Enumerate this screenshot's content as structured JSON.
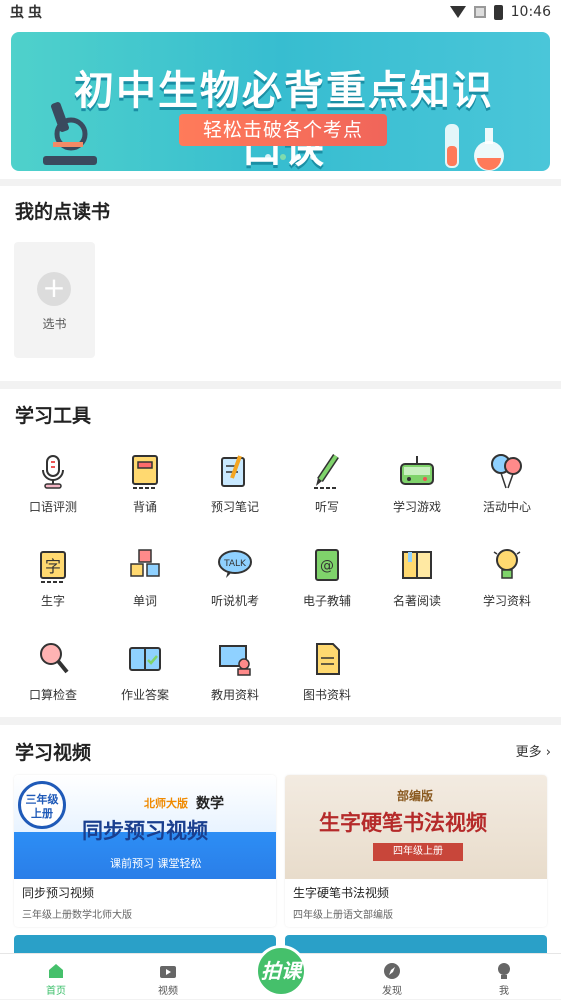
{
  "status_bar": {
    "left_icons": [
      "虫",
      "虫"
    ],
    "time": "10:46"
  },
  "banner": {
    "title": "初中生物必背重点知识口诀",
    "subtitle": "轻松击破各个考点",
    "slides": 4,
    "active_slide": 2
  },
  "my_books": {
    "title": "我的点读书",
    "add_label": "选书"
  },
  "tools": {
    "title": "学习工具",
    "items": [
      {
        "label": "口语评测",
        "icon": "microphone-icon"
      },
      {
        "label": "背诵",
        "icon": "book-icon"
      },
      {
        "label": "预习笔记",
        "icon": "notebook-pen-icon"
      },
      {
        "label": "听写",
        "icon": "pencil-icon"
      },
      {
        "label": "学习游戏",
        "icon": "gamepad-icon"
      },
      {
        "label": "活动中心",
        "icon": "balloons-icon"
      },
      {
        "label": "生字",
        "icon": "character-card-icon"
      },
      {
        "label": "单词",
        "icon": "letter-blocks-icon"
      },
      {
        "label": "听说机考",
        "icon": "talk-bubble-icon"
      },
      {
        "label": "电子教辅",
        "icon": "email-book-icon"
      },
      {
        "label": "名著阅读",
        "icon": "open-book-icon"
      },
      {
        "label": "学习资料",
        "icon": "lightbulb-icon"
      },
      {
        "label": "口算检查",
        "icon": "magnifier-icon"
      },
      {
        "label": "作业答案",
        "icon": "answer-book-icon"
      },
      {
        "label": "教用资料",
        "icon": "teacher-board-icon"
      },
      {
        "label": "图书资料",
        "icon": "document-icon"
      }
    ]
  },
  "videos": {
    "title": "学习视频",
    "more_label": "更多",
    "items": [
      {
        "title": "同步预习视频",
        "subtitle": "三年级上册数学北师大版",
        "thumb_badge": "三年级\n上册",
        "thumb_tag": "北师大版",
        "thumb_subject": "数学",
        "thumb_headline": "同步预习视频",
        "thumb_slogan": "课前预习 课堂轻松"
      },
      {
        "title": "生字硬笔书法视频",
        "subtitle": "四年级上册语文部编版",
        "thumb_tag": "部编版",
        "thumb_headline": "生字硬笔书法视频",
        "thumb_grade": "四年级上册"
      }
    ]
  },
  "tabbar": {
    "items": [
      {
        "label": "首页",
        "icon": "home-icon",
        "active": true
      },
      {
        "label": "视频",
        "icon": "tv-icon",
        "active": false
      },
      {
        "label": "发现",
        "icon": "compass-icon",
        "active": false
      },
      {
        "label": "我",
        "icon": "profile-icon",
        "active": false
      }
    ],
    "center_label": "拍课"
  },
  "colors": {
    "accent_green": "#45c06b",
    "banner_teal": "#37bdd0",
    "banner_orange": "#f0655a"
  }
}
